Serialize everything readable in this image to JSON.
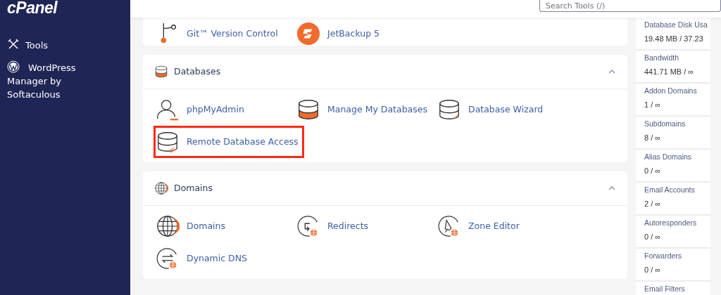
{
  "sidebar": {
    "logo": "cPanel",
    "items": [
      {
        "label": "Tools"
      },
      {
        "label": "WordPress Manager by Softaculous"
      }
    ]
  },
  "search": {
    "placeholder": "Search Tools (/)"
  },
  "sections": [
    {
      "items": [
        {
          "label": "Git™ Version Control",
          "highlighted": false
        },
        {
          "label": "JetBackup 5",
          "highlighted": false
        }
      ]
    },
    {
      "title": "Databases",
      "expanded": true,
      "items": [
        {
          "label": "phpMyAdmin",
          "highlighted": false
        },
        {
          "label": "Manage My Databases",
          "highlighted": false
        },
        {
          "label": "Database Wizard",
          "highlighted": false
        },
        {
          "label": "Remote Database Access",
          "highlighted": true
        }
      ]
    },
    {
      "title": "Domains",
      "expanded": true,
      "items": [
        {
          "label": "Domains",
          "highlighted": false
        },
        {
          "label": "Redirects",
          "highlighted": false
        },
        {
          "label": "Zone Editor",
          "highlighted": false
        },
        {
          "label": "Dynamic DNS",
          "highlighted": false
        }
      ]
    }
  ],
  "stats": [
    {
      "label": "Database Disk Usa",
      "value": "19.48 MB / 37.23"
    },
    {
      "label": "Bandwidth",
      "value": "441.71 MB / ∞"
    },
    {
      "label": "Addon Domains",
      "value": "1 / ∞"
    },
    {
      "label": "Subdomains",
      "value": "8 / ∞"
    },
    {
      "label": "Alias Domains",
      "value": "0 / ∞"
    },
    {
      "label": "Email Accounts",
      "value": "2 / ∞"
    },
    {
      "label": "Autoresponders",
      "value": "0 / ∞"
    },
    {
      "label": "Forwarders",
      "value": "0 / ∞"
    },
    {
      "label": "Email Filters"
    }
  ]
}
